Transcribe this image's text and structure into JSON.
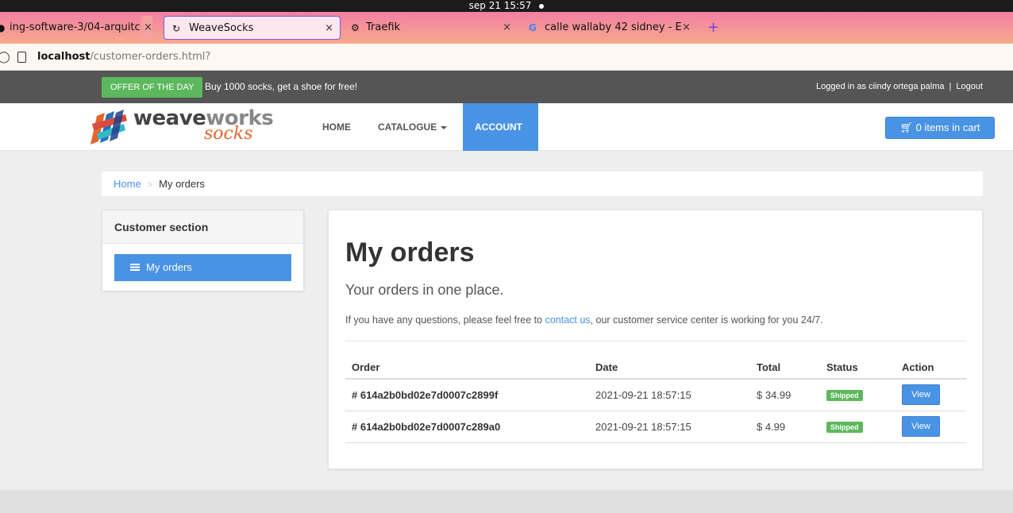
{
  "os": {
    "clock": "sep 21  15:57"
  },
  "browser": {
    "tabs": [
      {
        "label": "ing-software-3/04-arquitc",
        "close": "×"
      },
      {
        "label": "WeaveSocks",
        "close": "×"
      },
      {
        "label": "Traefik",
        "close": "×"
      },
      {
        "label": "calle wallaby 42 sidney - E",
        "close": "×"
      }
    ],
    "new_tab": "+",
    "url_host": "localhost",
    "url_path": "/customer-orders.html?"
  },
  "topbar": {
    "offer_label": "OFFER OF THE DAY",
    "offer_text": "Buy 1000 socks, get a shoe for free!",
    "logged_in": "Logged in as ciindy ortega palma",
    "separator": "|",
    "logout": "Logout"
  },
  "logo": {
    "text_main": "weave",
    "text_works": "works",
    "text_sub": "socks"
  },
  "nav": {
    "home": "HOME",
    "catalogue": "CATALOGUE",
    "account": "ACCOUNT",
    "cart": "0 items in cart"
  },
  "breadcrumb": {
    "home": "Home",
    "separator": ">",
    "current": "My orders"
  },
  "sidebar": {
    "title": "Customer section",
    "items": [
      {
        "label": "My orders"
      }
    ]
  },
  "main": {
    "title": "My orders",
    "lead": "Your orders in one place.",
    "info_before": "If you have any questions, please feel free to ",
    "info_link": "contact us",
    "info_after": ", our customer service center is working for you 24/7.",
    "table": {
      "headers": [
        "Order",
        "Date",
        "Total",
        "Status",
        "Action"
      ],
      "rows": [
        {
          "order": "# 614a2b0bd02e7d0007c2899f",
          "date": "2021-09-21 18:57:15",
          "total": "$ 34.99",
          "status": "Shipped",
          "action": "View"
        },
        {
          "order": "# 614a2b0bd02e7d0007c289a0",
          "date": "2021-09-21 18:57:15",
          "total": "$ 4.99",
          "status": "Shipped",
          "action": "View"
        }
      ]
    }
  },
  "colors": {
    "primary": "#4993e4",
    "success": "#5cb85c",
    "topbar": "#555555",
    "logo_accent": "#e7642a"
  }
}
